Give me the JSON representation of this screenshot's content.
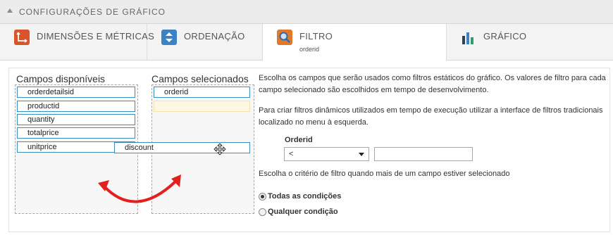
{
  "panel": {
    "title": "CONFIGURAÇÕES DE GRÁFICO"
  },
  "tabs": [
    {
      "label": "DIMENSÕES E MÉTRICAS",
      "icon": "dimensions-icon",
      "color": "#d9542b"
    },
    {
      "label": "ORDENAÇÃO",
      "icon": "sort-icon",
      "color": "#3d82c4"
    },
    {
      "label": "FILTRO",
      "sub": "orderid",
      "icon": "filter-search-icon",
      "color": "#e07a2a"
    },
    {
      "label": "GRÁFICO",
      "icon": "bar-chart-icon",
      "color": "#2f4150"
    }
  ],
  "available": {
    "title": "Campos disponíveis",
    "fields": [
      "orderdetailsid",
      "productid",
      "quantity",
      "totalprice",
      "unitprice"
    ]
  },
  "selected": {
    "title": "Campos selecionados",
    "fields": [
      "orderid"
    ]
  },
  "dragging": {
    "label": "discount"
  },
  "description": {
    "line1": "Escolha os campos que serão usados como filtros estáticos do gráfico. Os valores de filtro para cada",
    "line2": "campo selecionado são escolhidos em tempo de desenvolvimento.",
    "line3": "Para criar filtros dinâmicos utilizados em tempo de execução utilizar a interface de filtros tradicionais",
    "line4": "localizado no menu à esquerda."
  },
  "filter_row": {
    "label": "Orderid",
    "operator": "<",
    "value": ""
  },
  "criteria": {
    "text": "Escolha o critério de filtro quando mais de um campo estiver selecionado",
    "options": [
      {
        "label": "Todas as condições",
        "checked": true
      },
      {
        "label": "Qualquer condição",
        "checked": false
      }
    ]
  }
}
